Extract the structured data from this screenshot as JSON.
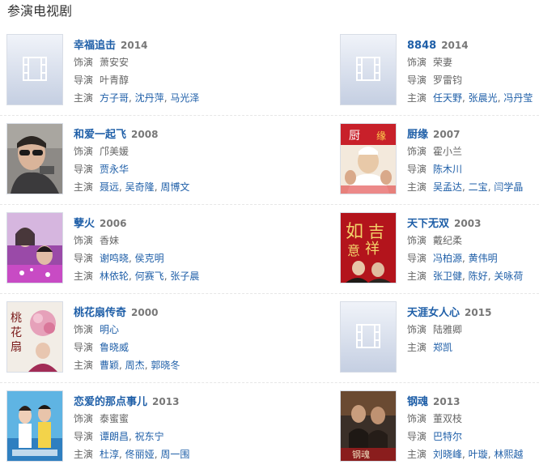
{
  "section_title": "参演电视剧",
  "labels": {
    "role": "饰演",
    "director": "导演",
    "cast": "主演"
  },
  "colors": {
    "link": "#1f5fa8",
    "label": "#666666",
    "year": "#777777"
  },
  "dramas": [
    {
      "title": "幸福追击",
      "year": "2014",
      "role": "萧安安",
      "role_link": false,
      "director": [
        "叶青醇"
      ],
      "director_link": false,
      "cast": [
        "方子哥",
        "沈丹萍",
        "马光泽"
      ],
      "poster": "placeholder-film-icon"
    },
    {
      "title": "8848",
      "year": "2014",
      "role": "荣妻",
      "role_link": false,
      "director": [
        "罗雷钧"
      ],
      "director_link": false,
      "cast": [
        "任天野",
        "张晨光",
        "冯丹莹"
      ],
      "poster": "placeholder-film-icon"
    },
    {
      "title": "和爱一起飞",
      "year": "2008",
      "role": "邝美媛",
      "role_link": false,
      "director": [
        "贾永华"
      ],
      "director_link": true,
      "cast": [
        "聂远",
        "吴奇隆",
        "周博文"
      ],
      "poster": "man-with-sunglasses"
    },
    {
      "title": "厨缘",
      "year": "2007",
      "role": "霍小兰",
      "role_link": false,
      "director": [
        "陈木川"
      ],
      "director_link": true,
      "cast": [
        "吴孟达",
        "二宝",
        "闫学晶"
      ],
      "poster": "chef-red-poster"
    },
    {
      "title": "孽火",
      "year": "2006",
      "role": "香妹",
      "role_link": false,
      "director": [
        "谢鸣晓",
        "侯克明"
      ],
      "director_link": true,
      "cast": [
        "林依轮",
        "何赛飞",
        "张子晨"
      ],
      "poster": "couple-purple-poster"
    },
    {
      "title": "天下无双",
      "year": "2003",
      "role": "戴纪柔",
      "role_link": false,
      "director": [
        "冯柏源",
        "黄伟明"
      ],
      "director_link": true,
      "cast": [
        "张卫健",
        "陈好",
        "关咏荷"
      ],
      "poster": "red-calligraphy-poster"
    },
    {
      "title": "桃花扇传奇",
      "year": "2000",
      "role": "明心",
      "role_link": true,
      "director": [
        "鲁晓威"
      ],
      "director_link": true,
      "cast": [
        "曹颖",
        "周杰",
        "郭晓冬"
      ],
      "poster": "peach-blossom-poster"
    },
    {
      "title": "天涯女人心",
      "year": "2015",
      "role": "陆雅卿",
      "role_link": false,
      "director": [],
      "director_link": false,
      "cast": [
        "郑凯"
      ],
      "poster": "placeholder-film-icon"
    },
    {
      "title": "恋爱的那点事儿",
      "year": "2013",
      "role": "泰蜜蜜",
      "role_link": false,
      "director": [
        "谭朗昌",
        "祝东宁"
      ],
      "director_link": true,
      "cast": [
        "杜淳",
        "佟丽娅",
        "周一围"
      ],
      "poster": "blue-couple-poster"
    },
    {
      "title": "钢魂",
      "year": "2013",
      "role": "董双枝",
      "role_link": false,
      "director": [
        "巴特尔"
      ],
      "director_link": true,
      "cast": [
        "刘晓峰",
        "叶璇",
        "林熙越"
      ],
      "poster": "dark-steel-poster"
    }
  ]
}
